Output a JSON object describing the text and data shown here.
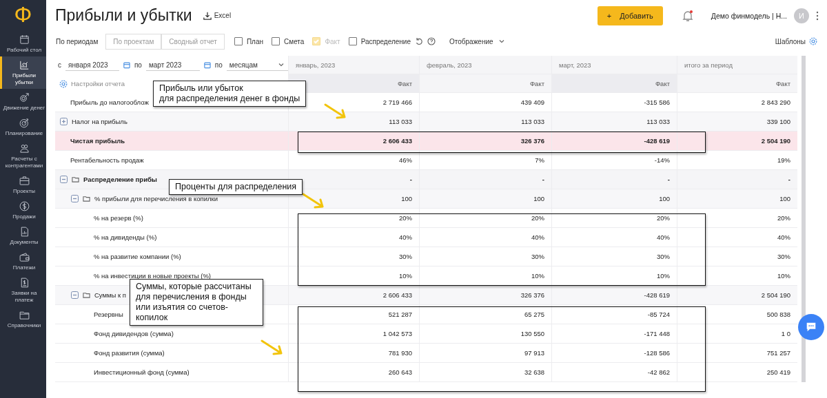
{
  "logo": "Ф",
  "sidebar": {
    "items": [
      {
        "label": "Рабочий стол",
        "selected": false
      },
      {
        "label": "Прибыли убытки",
        "selected": true
      },
      {
        "label": "Движение денег",
        "selected": false
      },
      {
        "label": "Планирование",
        "selected": false
      },
      {
        "label": "Расчеты с контрагентами",
        "selected": false
      },
      {
        "label": "Проекты",
        "selected": false
      },
      {
        "label": "Продажи",
        "selected": false
      },
      {
        "label": "Документы",
        "selected": false
      },
      {
        "label": "Платежи",
        "selected": false
      },
      {
        "label": "Заявки на платеж",
        "selected": false
      },
      {
        "label": "Справочники",
        "selected": false
      }
    ]
  },
  "header": {
    "title": "Прибыли и убытки",
    "export": "Excel",
    "add_button": {
      "icon": "+",
      "label": "Добавить"
    },
    "notification_dot": true,
    "account": "Демо финмодель | Н...",
    "avatar": "И"
  },
  "toolbar": {
    "views": [
      {
        "label": "По периодам",
        "selected": true
      },
      {
        "label": "По проектам",
        "selected": false
      },
      {
        "label": "Сводный отчет",
        "selected": false
      }
    ],
    "checkboxes": [
      {
        "label": "План",
        "checked": false,
        "disabled": false
      },
      {
        "label": "Смета",
        "checked": false,
        "disabled": false
      },
      {
        "label": "Факт",
        "checked": true,
        "disabled": true
      },
      {
        "label": "Распределение",
        "checked": false,
        "disabled": false
      }
    ],
    "display": "Отображение",
    "templates": "Шаблоны"
  },
  "filters": {
    "from_label": "с",
    "from": "января 2023",
    "to_label": "по",
    "to": "март 2023",
    "step_label": "по",
    "step": "месяцам"
  },
  "table": {
    "settings": "Настройки отчета",
    "columns": [
      {
        "title": "январь, 2023",
        "sub": "Факт"
      },
      {
        "title": "февраль, 2023",
        "sub": "Факт"
      },
      {
        "title": "март, 2023",
        "sub": "Факт"
      },
      {
        "title": "итого за период",
        "sub": "Факт"
      }
    ],
    "rows": [
      {
        "label": "Прибыль до налогооблож",
        "values": [
          "2 719 466",
          "439 409",
          "-315 586",
          "2 843 290"
        ]
      },
      {
        "label": "Налог на прибыль",
        "kind": "group",
        "expanded": false,
        "values": [
          "113 033",
          "113 033",
          "113 033",
          "339 100"
        ]
      },
      {
        "label": "Чистая прибыль",
        "kind": "total",
        "values": [
          "2 606 433",
          "326 376",
          "-428 619",
          "2 504 190"
        ]
      },
      {
        "label": "Рентабельность продаж",
        "values": [
          "46%",
          "7%",
          "-14%",
          "19%"
        ]
      },
      {
        "label": "Распределение прибы",
        "kind": "section",
        "expanded": true,
        "values": [
          "-",
          "-",
          "-",
          "-"
        ],
        "children": [
          {
            "label": "% прибыли для перечисления в  копилки",
            "kind": "group",
            "expanded": true,
            "values": [
              "100",
              "100",
              "100",
              "100"
            ],
            "children": [
              {
                "label": "% на резерв (%)",
                "values": [
                  "20%",
                  "20%",
                  "20%",
                  "20%"
                ]
              },
              {
                "label": "% на дивиденды (%)",
                "values": [
                  "40%",
                  "40%",
                  "40%",
                  "40%"
                ]
              },
              {
                "label": "% на развитие компании (%)",
                "values": [
                  "30%",
                  "30%",
                  "30%",
                  "30%"
                ]
              },
              {
                "label": "% на инвестиции в новые проекты (%)",
                "values": [
                  "10%",
                  "10%",
                  "10%",
                  "10%"
                ]
              }
            ]
          },
          {
            "label": "Суммы к п",
            "kind": "group",
            "expanded": true,
            "values": [
              "2 606 433",
              "326 376",
              "-428 619",
              "2 504 190"
            ],
            "children": [
              {
                "label": "Резервны",
                "values": [
                  "521 287",
                  "65 275",
                  "-85 724",
                  "500 838"
                ]
              },
              {
                "label": "Фонд дивидендов (сумма)",
                "values": [
                  "1 042 573",
                  "130 550",
                  "-171 448",
                  "1 0"
                ]
              },
              {
                "label": "Фонд развития (сумма)",
                "values": [
                  "781 930",
                  "97 913",
                  "-128 586",
                  "751 257"
                ]
              },
              {
                "label": "Инвестиционный фонд (сумма)",
                "values": [
                  "260 643",
                  "32 638",
                  "-42 862",
                  "250 419"
                ]
              }
            ]
          }
        ]
      }
    ]
  },
  "annotations": [
    {
      "text": "Прибыль или убыток\nдля распределения денег в фонды"
    },
    {
      "text": "Проценты для распределения"
    },
    {
      "text": "Суммы, которые рассчитаны для перечисления в фонды или изъятия со счетов-копилок"
    }
  ]
}
